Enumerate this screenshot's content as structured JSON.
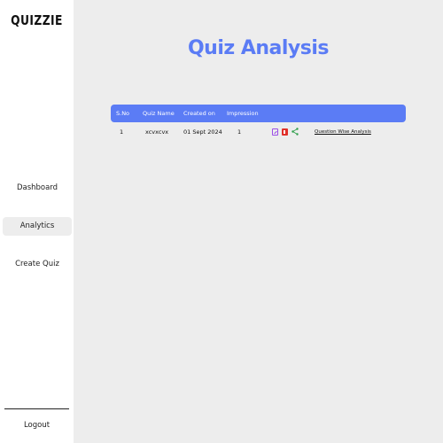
{
  "app": {
    "logo": "QUIZZIE"
  },
  "sidebar": {
    "items": [
      {
        "label": "Dashboard"
      },
      {
        "label": "Analytics"
      },
      {
        "label": "Create Quiz"
      }
    ],
    "logout": "Logout"
  },
  "main": {
    "title": "Quiz Analysis",
    "table": {
      "headers": [
        "S.No",
        "Quiz Name",
        "Created on",
        "Impression"
      ],
      "rows": [
        {
          "sno": "1",
          "name": "xcvxcvx",
          "created": "01 Sept 2024",
          "impressions": "1",
          "link": "Question Wise Analysis"
        }
      ]
    }
  },
  "colors": {
    "accent": "#5b7cf5",
    "edit": "#9b4de6",
    "delete": "#e0302a",
    "share": "#2e9e4a"
  },
  "icons": [
    "edit-icon",
    "delete-icon",
    "share-icon"
  ]
}
